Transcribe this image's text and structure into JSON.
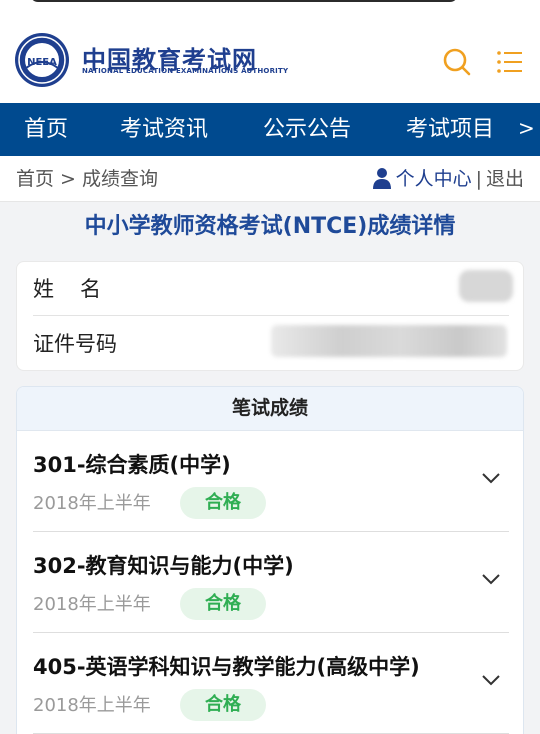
{
  "header": {
    "logo_cn": "中国教育考试网",
    "logo_en": "NATIONAL EDUCATION EXAMINATIONS AUTHORITY",
    "logo_emblem_text": "NEEA",
    "icons": {
      "search": "search-icon",
      "menu": "menu-icon"
    },
    "accent_color": "#f0a020"
  },
  "nav": {
    "items": [
      {
        "label": "首页"
      },
      {
        "label": "考试资讯"
      },
      {
        "label": "公示公告"
      },
      {
        "label": "考试项目"
      }
    ],
    "more": ">",
    "background": "#004a8f"
  },
  "breadcrumb": {
    "text": "首页 > 成绩查询",
    "user_center": "个人中心",
    "separator": "|",
    "logout": "退出"
  },
  "page_title": "中小学教师资格考试(NTCE)成绩详情",
  "info": {
    "name_label": "姓名",
    "id_label": "证件号码"
  },
  "scores": {
    "header": "笔试成绩",
    "subjects": [
      {
        "name": "301-综合素质(中学)",
        "term": "2018年上半年",
        "status": "合格"
      },
      {
        "name": "302-教育知识与能力(中学)",
        "term": "2018年上半年",
        "status": "合格"
      },
      {
        "name": "405-英语学科知识与教学能力(高级中学)",
        "term": "2018年上半年",
        "status": "合格"
      }
    ],
    "pass_color": "#2fae53"
  }
}
